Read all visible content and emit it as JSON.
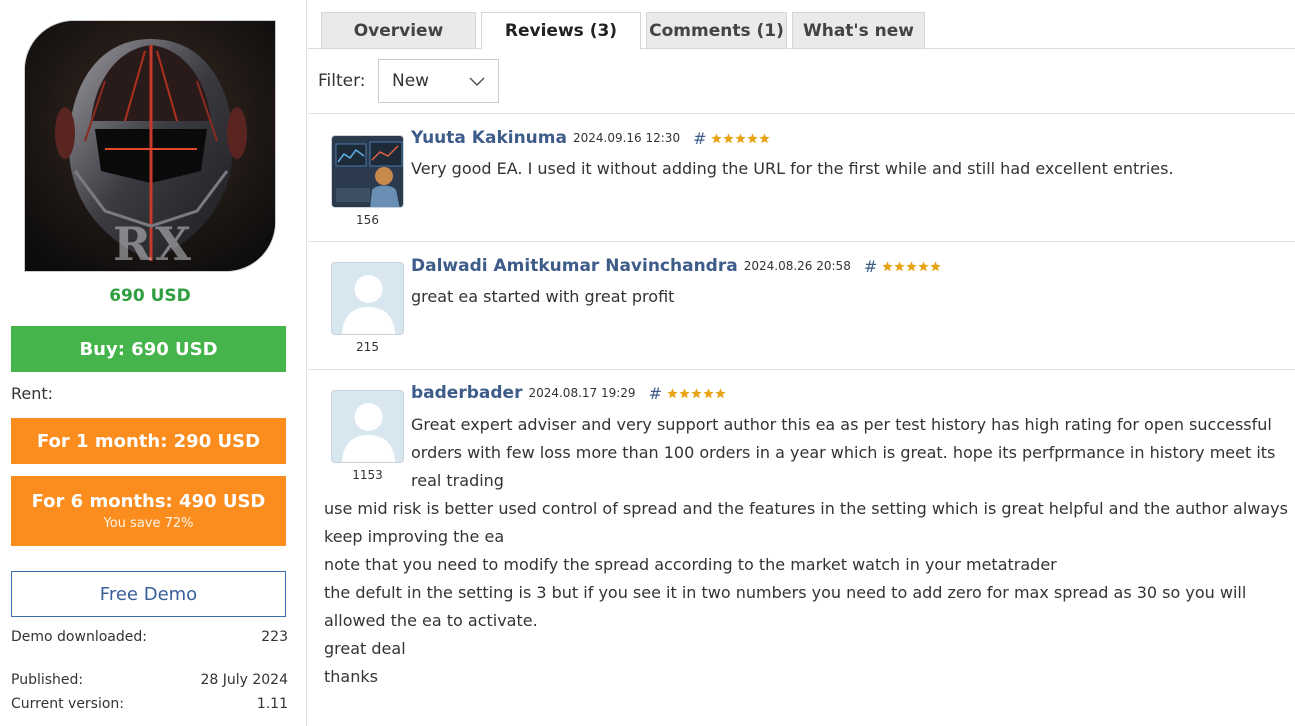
{
  "sidebar": {
    "logo_text": "RX",
    "price": "690 USD",
    "buy_label": "Buy: 690 USD",
    "rent_label": "Rent:",
    "rent_1_label": "For 1 month: 290 USD",
    "rent_6_label": "For 6 months: 490 USD",
    "rent_6_save": "You save 72%",
    "demo_label": "Free Demo",
    "stats": [
      {
        "label": "Demo downloaded:",
        "value": "223"
      },
      {
        "label": "Published:",
        "value": "28 July 2024"
      },
      {
        "label": "Current version:",
        "value": "1.11"
      }
    ]
  },
  "tabs": [
    {
      "label": "Overview"
    },
    {
      "label": "Reviews (3)",
      "active": true
    },
    {
      "label": "Comments (1)"
    },
    {
      "label": "What's new"
    }
  ],
  "filter": {
    "label": "Filter:",
    "selected": "New"
  },
  "reviews": [
    {
      "author": "Yuuta Kakinuma",
      "date": "2024.09.16 12:30",
      "hash": "#",
      "rating": 5,
      "avatar_count": "156",
      "lines": [
        "Very good EA. I used it without adding the URL for the first while and still had excellent entries."
      ]
    },
    {
      "author": "Dalwadi Amitkumar Navinchandra",
      "date": "2024.08.26 20:58",
      "hash": "#",
      "rating": 5,
      "avatar_count": "215",
      "lines": [
        "great ea started with great profit"
      ]
    },
    {
      "author": "baderbader",
      "date": "2024.08.17 19:29",
      "hash": "#",
      "rating": 5,
      "avatar_count": "1153",
      "lines": [
        "Great expert adviser and very support author this ea as per test history has high rating for open successful",
        "orders with few loss more than 100 orders in a year which is great. hope its perfprmance in history meet its",
        "real trading",
        "use mid risk is better used control of spread and the features in the setting which is great helpful and the author always",
        "keep improving the ea",
        "note that you need to modify the spread according to the market watch in your metatrader",
        "the defult in the setting is 3 but if you see it in two numbers you need to add zero for max spread as 30 so you will",
        "allowed the ea to activate.",
        "great deal",
        "thanks"
      ]
    }
  ],
  "colors": {
    "price_green": "#2e9e3e",
    "buy_green": "#45b44a",
    "rent_orange": "#fb8c1e",
    "link_blue": "#3e5c8a",
    "star_gold": "#e8a317"
  }
}
